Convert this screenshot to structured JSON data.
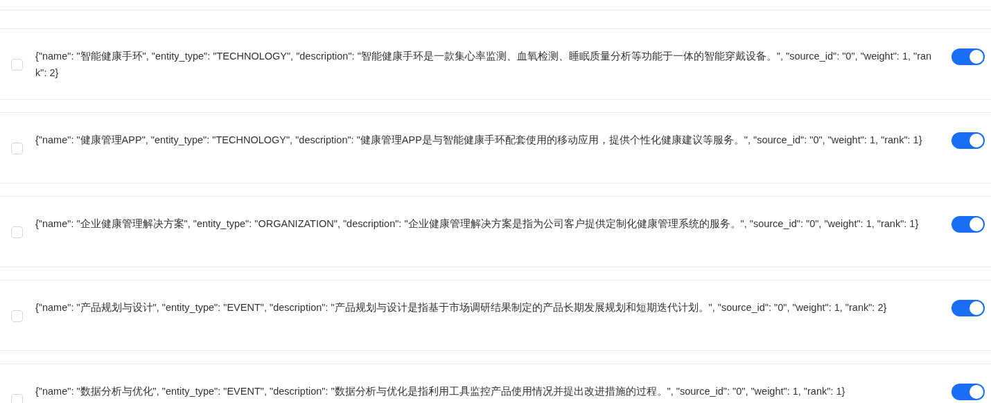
{
  "rows": [
    {
      "text": "{\"name\": \"智能健康手环\", \"entity_type\": \"TECHNOLOGY\", \"description\": \"智能健康手环是一款集心率监测、血氧检测、睡眠质量分析等功能于一体的智能穿戴设备。\", \"source_id\": \"0\", \"weight\": 1, \"rank\": 2}",
      "checked": false,
      "on": true
    },
    {
      "text": "{\"name\": \"健康管理APP\", \"entity_type\": \"TECHNOLOGY\", \"description\": \"健康管理APP是与智能健康手环配套使用的移动应用，提供个性化健康建议等服务。\", \"source_id\": \"0\", \"weight\": 1, \"rank\": 1}",
      "checked": false,
      "on": true
    },
    {
      "text": "{\"name\": \"企业健康管理解决方案\", \"entity_type\": \"ORGANIZATION\", \"description\": \"企业健康管理解决方案是指为公司客户提供定制化健康管理系统的服务。\", \"source_id\": \"0\", \"weight\": 1, \"rank\": 1}",
      "checked": false,
      "on": true
    },
    {
      "text": "{\"name\": \"产品规划与设计\", \"entity_type\": \"EVENT\", \"description\": \"产品规划与设计是指基于市场调研结果制定的产品长期发展规划和短期迭代计划。\", \"source_id\": \"0\", \"weight\": 1, \"rank\": 2}",
      "checked": false,
      "on": true
    },
    {
      "text": "{\"name\": \"数据分析与优化\", \"entity_type\": \"EVENT\", \"description\": \"数据分析与优化是指利用工具监控产品使用情况并提出改进措施的过程。\", \"source_id\": \"0\", \"weight\": 1, \"rank\": 1}",
      "checked": false,
      "on": true
    }
  ]
}
